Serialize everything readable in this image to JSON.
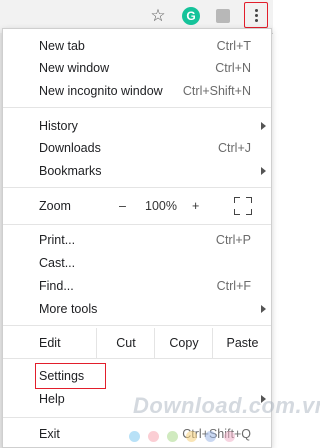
{
  "toolbar": {
    "bookmark_star_icon": "star-outline",
    "grammarly_icon": "G",
    "extension_icon": "extension-icon",
    "menu_icon": "more-vertical-icon",
    "highlight_color": "#e21e2b"
  },
  "menu": {
    "group1": [
      {
        "label": "New tab",
        "shortcut": "Ctrl+T"
      },
      {
        "label": "New window",
        "shortcut": "Ctrl+N"
      },
      {
        "label": "New incognito window",
        "shortcut": "Ctrl+Shift+N"
      }
    ],
    "group2": [
      {
        "label": "History",
        "has_submenu": true
      },
      {
        "label": "Downloads",
        "shortcut": "Ctrl+J"
      },
      {
        "label": "Bookmarks",
        "has_submenu": true
      }
    ],
    "zoom": {
      "label": "Zoom",
      "minus": "–",
      "value": "100%",
      "plus": "+"
    },
    "group3": [
      {
        "label": "Print...",
        "shortcut": "Ctrl+P"
      },
      {
        "label": "Cast..."
      },
      {
        "label": "Find...",
        "shortcut": "Ctrl+F"
      },
      {
        "label": "More tools",
        "has_submenu": true
      }
    ],
    "edit": {
      "label": "Edit",
      "cut": "Cut",
      "copy": "Copy",
      "paste": "Paste"
    },
    "group4": [
      {
        "label": "Settings"
      },
      {
        "label": "Help",
        "has_submenu": true
      }
    ],
    "exit": {
      "label": "Exit",
      "shortcut": "Ctrl+Shift+Q"
    }
  },
  "watermark": {
    "text": "Download.com.vn",
    "dot_colors": [
      "#7ec8f0",
      "#f7a5b0",
      "#a9d98a",
      "#f5d07a",
      "#9fb8e8",
      "#f0b0c8"
    ]
  }
}
